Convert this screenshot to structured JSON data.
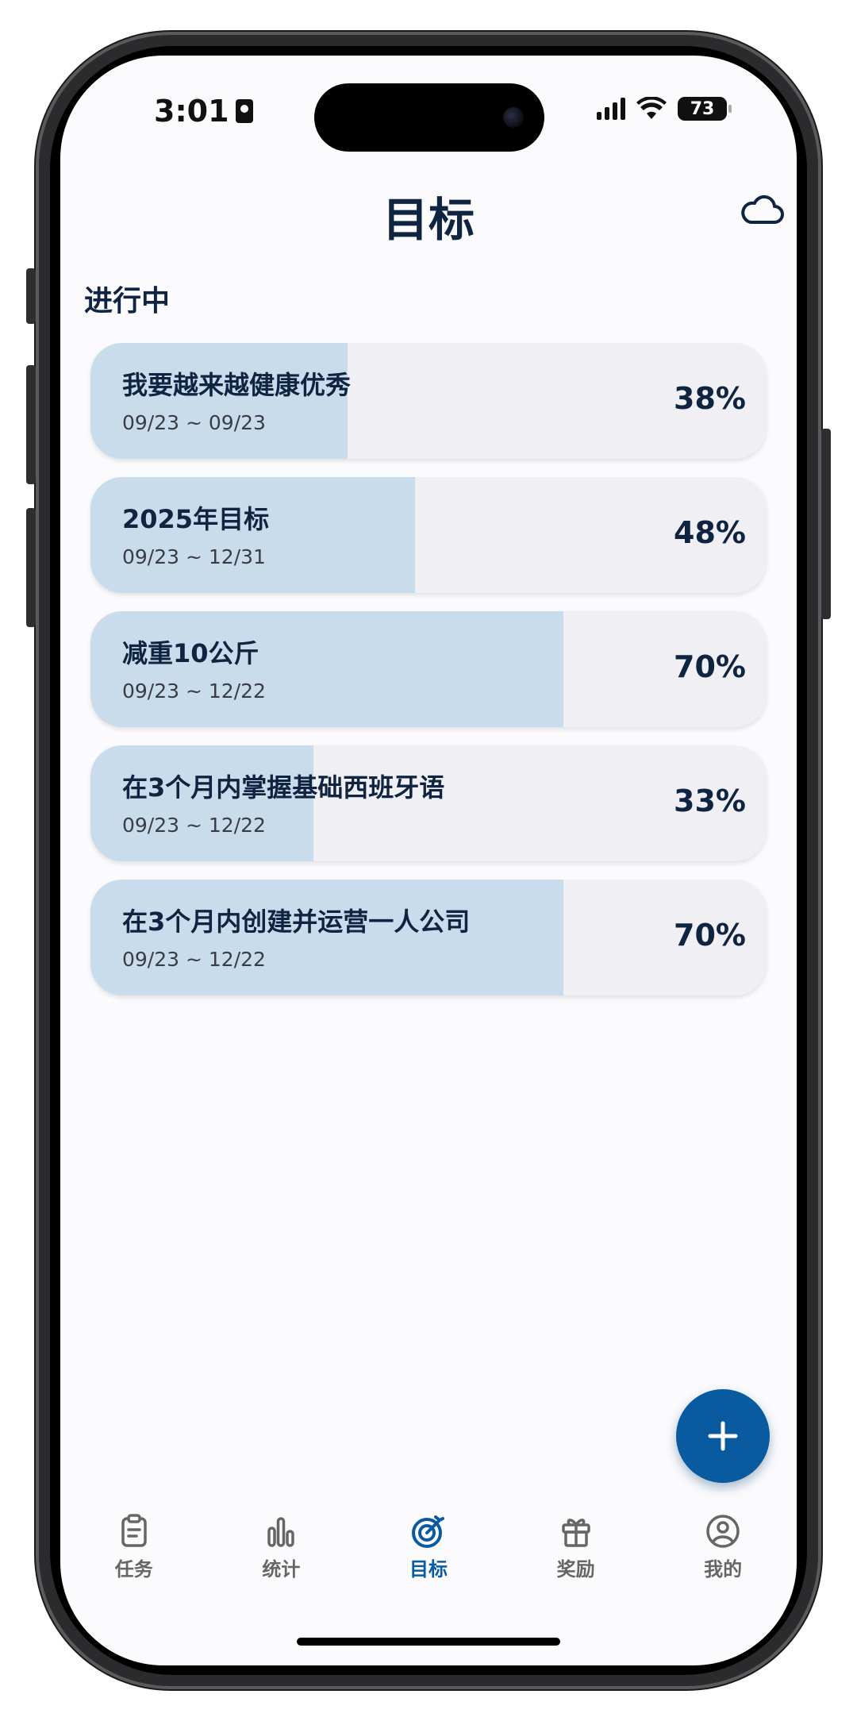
{
  "status_bar": {
    "time": "3:01",
    "battery": "73"
  },
  "header": {
    "title": "目标"
  },
  "section": {
    "label": "进行中"
  },
  "goals": [
    {
      "name": "我要越来越健康优秀",
      "date_range": "09/23 ~ 09/23",
      "percent_label": "38%",
      "progress": 0.38
    },
    {
      "name": "2025年目标",
      "date_range": "09/23 ~ 12/31",
      "percent_label": "48%",
      "progress": 0.48
    },
    {
      "name": "减重10公斤",
      "date_range": "09/23 ~ 12/22",
      "percent_label": "70%",
      "progress": 0.7
    },
    {
      "name": "在3个月内掌握基础西班牙语",
      "date_range": "09/23 ~ 12/22",
      "percent_label": "33%",
      "progress": 0.33
    },
    {
      "name": "在3个月内创建并运营一人公司",
      "date_range": "09/23 ~ 12/22",
      "percent_label": "70%",
      "progress": 0.7
    }
  ],
  "tabs": [
    {
      "label": "任务",
      "icon": "clipboard-icon"
    },
    {
      "label": "统计",
      "icon": "bar-chart-icon"
    },
    {
      "label": "目标",
      "icon": "target-icon",
      "active": true
    },
    {
      "label": "奖励",
      "icon": "gift-icon"
    },
    {
      "label": "我的",
      "icon": "user-circle-icon"
    }
  ],
  "colors": {
    "accent": "#0a5aa0",
    "title": "#0f2440",
    "progress_fill": "#c9dceb",
    "card_bg": "#efeff4"
  }
}
